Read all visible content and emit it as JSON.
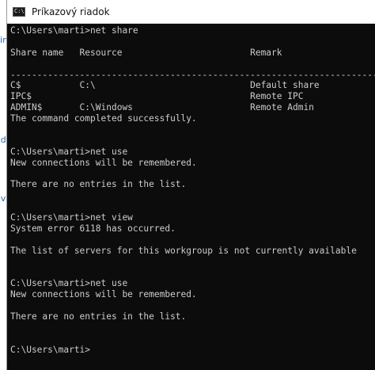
{
  "background_fragments": [
    "cin",
    "ade",
    "ove"
  ],
  "window": {
    "title": "Príkazový riadok",
    "icon_label": "C:\\"
  },
  "console": {
    "lines": [
      "C:\\Users\\marti>net share",
      "",
      "Share name   Resource                        Remark",
      "",
      "-------------------------------------------------------------------------------",
      "C$           C:\\                             Default share",
      "IPC$                                         Remote IPC",
      "ADMIN$       C:\\Windows                      Remote Admin",
      "The command completed successfully.",
      "",
      "",
      "C:\\Users\\marti>net use",
      "New connections will be remembered.",
      "",
      "There are no entries in the list.",
      "",
      "",
      "C:\\Users\\marti>net view",
      "System error 6118 has occurred.",
      "",
      "The list of servers for this workgroup is not currently available",
      "",
      "",
      "C:\\Users\\marti>net use",
      "New connections will be remembered.",
      "",
      "There are no entries in the list.",
      "",
      "",
      "C:\\Users\\marti>"
    ]
  }
}
